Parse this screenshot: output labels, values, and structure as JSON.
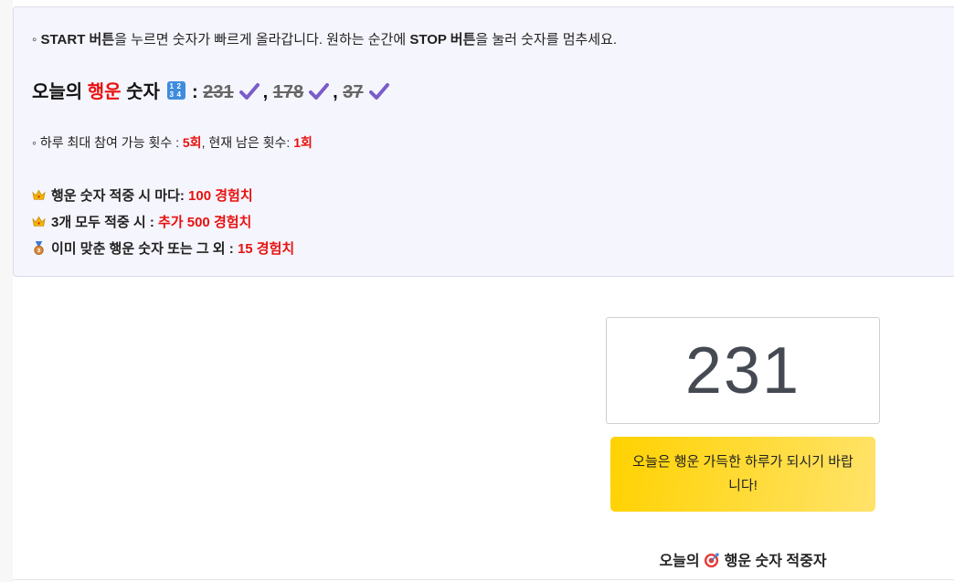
{
  "instructions": {
    "bullet": "◦",
    "part1_bold": "START 버튼",
    "part2": "을 누르면 숫자가 빠르게 올라갑니다. 원하는 순간에 ",
    "part3_bold": "STOP 버튼",
    "part4": "을 눌러 숫자를 멈추세요."
  },
  "lucky_numbers": {
    "title_prefix": "오늘의 ",
    "title_highlight": "행운",
    "title_suffix": " 숫자",
    "separator": " :",
    "comma": ",",
    "numbers": [
      "231",
      "178",
      "37"
    ]
  },
  "attempts": {
    "bullet": "◦",
    "label": "하루 최대 참여 가능 횟수 : ",
    "max_value": "5회",
    "mid": ", 현재 남은 횟수: ",
    "remaining_value": "1회"
  },
  "rewards": [
    {
      "icon": "crown-icon",
      "label": "행운 숫자 적중 시 마다: ",
      "value": "100 경험치"
    },
    {
      "icon": "crown-icon",
      "label": "3개 모두 적중 시 : ",
      "value": "추가 500 경험치"
    },
    {
      "icon": "medal-icon",
      "label": "이미 맞춘 행운 숫자 또는 그 외 : ",
      "value": "15 경험치"
    }
  ],
  "display": {
    "current_number": "231"
  },
  "message": {
    "text": "오늘은 행운 가득한 하루가 되시기 바랍니다!"
  },
  "winners": {
    "title_prefix": "오늘의",
    "title_suffix": "행운 숫자 적중자"
  },
  "colors": {
    "highlight_red": "#e8110f",
    "panel_background": "#f5f5fd",
    "message_yellow": "#ffd200",
    "check_purple": "#7b5cc9",
    "numpad_blue": "#3f8cdf"
  }
}
